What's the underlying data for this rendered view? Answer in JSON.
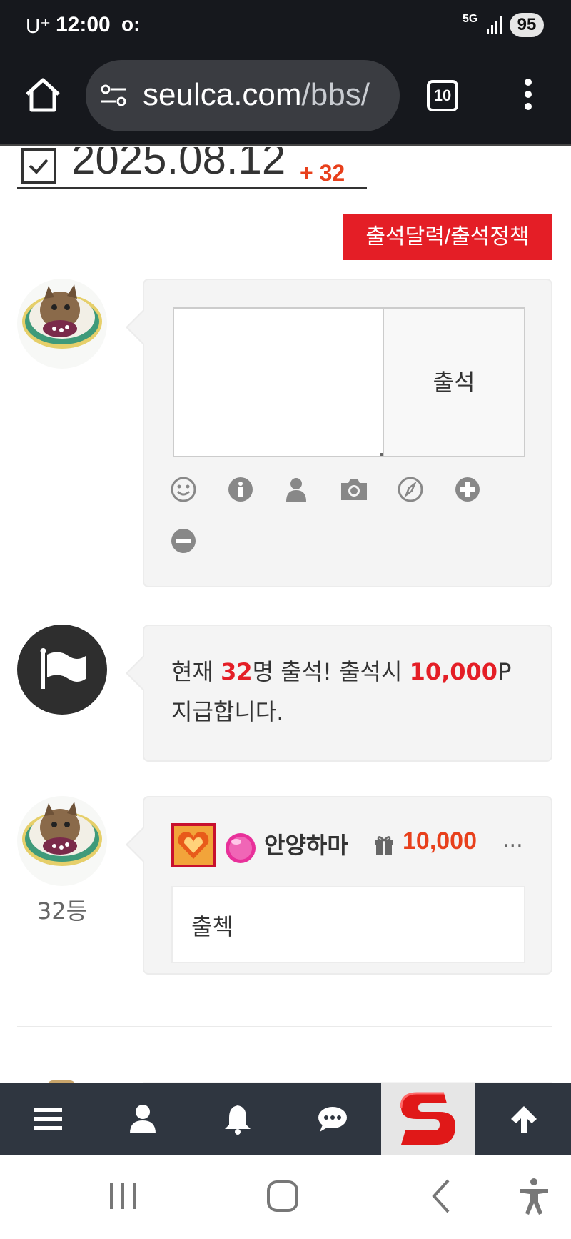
{
  "status_bar": {
    "carrier": "U⁺",
    "time": "12:00",
    "notification_glyph": "o:",
    "network": "5G",
    "battery": "95"
  },
  "browser": {
    "url_host": "seulca.com",
    "url_path": "/bbs/",
    "tab_count": "10"
  },
  "attendance": {
    "date": "2025.08.12",
    "count_badge": "+ 32",
    "calendar_button": "출석달력/출석정책",
    "form": {
      "comment_value": "",
      "submit_label": "출석",
      "tools": [
        "emoji-icon",
        "info-icon",
        "user-icon",
        "camera-icon",
        "compass-icon",
        "plus-icon",
        "minus-icon"
      ]
    },
    "notice": {
      "prefix": "현재 ",
      "count": "32",
      "middle": "명 출석! 출석시 ",
      "points": "10,000",
      "suffix": "P",
      "line2": "지급합니다."
    },
    "entry": {
      "rank": "32등",
      "username": "안양하마",
      "points": "10,000",
      "more": "...",
      "content": "출첵"
    }
  },
  "toolbar": {
    "items": [
      "menu-icon",
      "user-icon",
      "bell-icon",
      "chat-icon",
      "site-logo",
      "arrow-up-icon"
    ]
  },
  "colors": {
    "accent_red": "#e41e26",
    "points_orange": "#e8401c",
    "toolbar_bg": "#2f3640",
    "browser_bg": "#16181d"
  }
}
